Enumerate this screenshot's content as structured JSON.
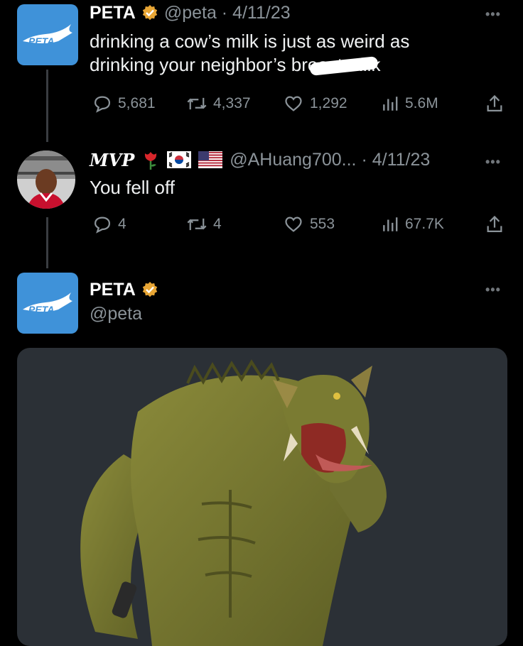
{
  "tweet1": {
    "name": "PETA",
    "meta": "@peta · 4/11/23",
    "text_line1": "drinking a cow’s milk is just as weird as",
    "text_line2": "drinking your neighbor’s breast milk",
    "stats": {
      "replies": "5,681",
      "retweets": "4,337",
      "likes": "1,292",
      "views": "5.6M"
    }
  },
  "tweet2": {
    "name": "MVP",
    "meta": "@AHuang700... · 4/11/23",
    "text": "You fell off",
    "stats": {
      "replies": "4",
      "retweets": "4",
      "likes": "553",
      "views": "67.7K"
    }
  },
  "tweet3": {
    "name": "PETA",
    "handle": "@peta"
  },
  "avatar_logo_text": "PETA",
  "colors": {
    "background": "#000000",
    "peta_blue": "#3f92d9",
    "verified_gold": "#e8a635",
    "muted": "#8b9399"
  },
  "icons": [
    "verified-badge-icon",
    "reply-icon",
    "retweet-icon",
    "like-icon",
    "views-icon",
    "share-icon",
    "more-icon",
    "rose-emoji",
    "korea-flag-emoji",
    "us-flag-emoji"
  ]
}
